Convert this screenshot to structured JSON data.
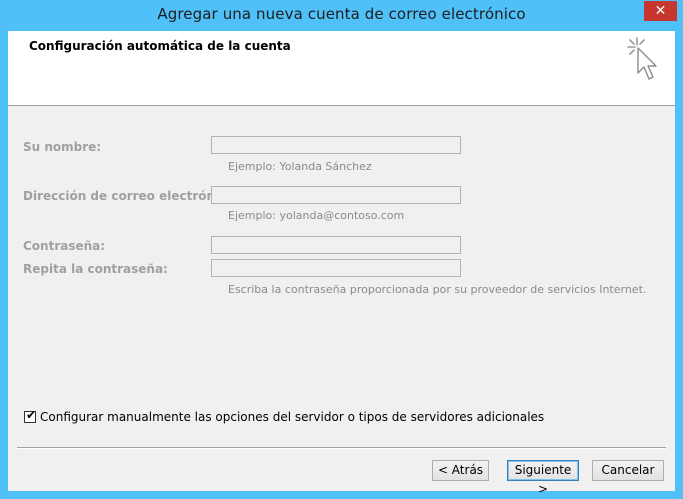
{
  "window": {
    "title": "Agregar una nueva cuenta de correo electrónico",
    "close_label": "✕"
  },
  "header": {
    "title": "Configuración automática de la cuenta",
    "icon": "wizard-cursor-icon"
  },
  "form": {
    "name": {
      "label": "Su nombre:",
      "value": "",
      "hint": "Ejemplo: Yolanda Sánchez"
    },
    "email": {
      "label": "Dirección de correo electrónico:",
      "value": "",
      "hint": "Ejemplo: yolanda@contoso.com"
    },
    "password": {
      "label": "Contraseña:",
      "value": ""
    },
    "password_repeat": {
      "label": "Repita la contraseña:",
      "value": "",
      "hint": "Escriba la contraseña proporcionada por su proveedor de servicios Internet."
    }
  },
  "manual_config": {
    "checked": true,
    "mark": "✔",
    "label": "Configurar manualmente las opciones del servidor o tipos de servidores adicionales"
  },
  "buttons": {
    "back": "< Atrás",
    "next": "Siguiente >",
    "cancel": "Cancelar"
  },
  "colors": {
    "titlebar": "#4fc0f8",
    "close": "#c7372f",
    "dialog_bg": "#f0f0f0",
    "disabled_text": "#a0a0a0"
  }
}
